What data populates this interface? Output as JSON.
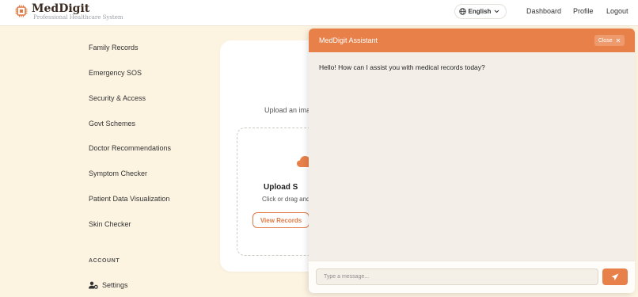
{
  "header": {
    "brand": "MedDigit",
    "tagline": "Professional Healthcare System",
    "language": "English",
    "nav": {
      "dashboard": "Dashboard",
      "profile": "Profile",
      "logout": "Logout"
    }
  },
  "sidebar": {
    "items": [
      {
        "label": "Family Records"
      },
      {
        "label": "Emergency SOS"
      },
      {
        "label": "Security & Access"
      },
      {
        "label": "Govt Schemes"
      },
      {
        "label": "Doctor Recommendations"
      },
      {
        "label": "Symptom Checker"
      },
      {
        "label": "Patient Data Visualization"
      },
      {
        "label": "Skin Checker"
      }
    ],
    "account_label": "ACCOUNT",
    "settings_label": "Settings"
  },
  "upload": {
    "intro": "Upload an ima",
    "title": "Upload S",
    "subtitle": "Click or drag and",
    "view_records": "View Records"
  },
  "chat": {
    "title": "MedDigit Assistant",
    "close_label": "Close",
    "message": "Hello! How can I assist you with medical records today?",
    "input_placeholder": "Type a message..."
  },
  "colors": {
    "accent": "#e8804a",
    "background": "#fdf3e1",
    "chat_bg": "#f3efe8"
  },
  "icons": [
    "chip-logo-icon",
    "globe-icon",
    "chevron-down-icon",
    "user-gear-icon",
    "cloud-upload-icon",
    "close-icon",
    "send-icon"
  ]
}
